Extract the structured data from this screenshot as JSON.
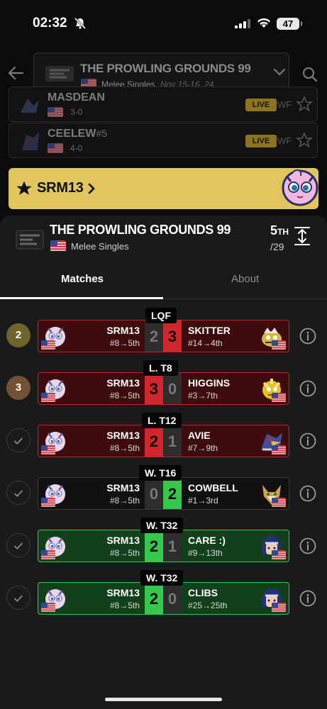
{
  "status_bar": {
    "time": "02:32",
    "battery": "47"
  },
  "top_bar": {
    "tournament_title": "THE PROWLING GROUNDS 99",
    "game": "Melee Singles",
    "dates": "Nov 15-16, 24"
  },
  "background_rows": [
    {
      "name": "MASDEAN",
      "seed": "",
      "record": "3-0",
      "live": "LIVE",
      "round": "WF"
    },
    {
      "name": "CEELEW",
      "seed": "#5",
      "record": "4-0",
      "live": "LIVE",
      "round": "WF"
    }
  ],
  "player_banner": {
    "name": "SRM13"
  },
  "sheet": {
    "title": "THE PROWLING GROUNDS 99",
    "game": "Melee Singles",
    "placing": "5",
    "placing_suffix": "TH",
    "entrants": "/29"
  },
  "tabs": [
    {
      "label": "Matches"
    },
    {
      "label": "About"
    }
  ],
  "matches": [
    {
      "status": "2",
      "round": "LQF",
      "box": "loss",
      "p1": "SRM13",
      "p1_seed": "#8→5th",
      "s1": "2",
      "s2": "3",
      "s1_style": "dim",
      "s2_style": "red",
      "p2": "SKITTER",
      "p2_seed": "#14→4th",
      "p2_char": "bowser"
    },
    {
      "status": "3",
      "round": "L. T8",
      "box": "loss",
      "p1": "SRM13",
      "p1_seed": "#8→5th",
      "s1": "3",
      "s2": "0",
      "s1_style": "red",
      "s2_style": "dim",
      "p2": "HIGGINS",
      "p2_seed": "#3→7th",
      "p2_char": "yellow"
    },
    {
      "status": "check",
      "round": "L. T12",
      "box": "loss",
      "p1": "SRM13",
      "p1_seed": "#8→5th",
      "s1": "2",
      "s2": "1",
      "s1_style": "red",
      "s2_style": "dim",
      "p2": "AVIE",
      "p2_seed": "#7→9th",
      "p2_char": "falco"
    },
    {
      "status": "check",
      "round": "W. T16",
      "box": "neutral",
      "p1": "SRM13",
      "p1_seed": "#8→5th",
      "s1": "0",
      "s2": "2",
      "s1_style": "dim",
      "s2_style": "grn",
      "p2": "COWBELL",
      "p2_seed": "#1→3rd",
      "p2_char": "fox"
    },
    {
      "status": "check",
      "round": "W. T32",
      "box": "win",
      "p1": "SRM13",
      "p1_seed": "#8→5th",
      "s1": "2",
      "s2": "1",
      "s1_style": "grn",
      "s2_style": "dim",
      "p2": "CARE :)",
      "p2_seed": "#9→13th",
      "p2_char": "marth"
    },
    {
      "status": "check",
      "round": "W. T32",
      "box": "win",
      "p1": "SRM13",
      "p1_seed": "#8→5th",
      "s1": "2",
      "s2": "0",
      "s1_style": "grn",
      "s2_style": "dim",
      "p2": "CLIBS",
      "p2_seed": "#25→25th",
      "p2_char": "marth"
    }
  ],
  "colors": {
    "accent_yellow": "#e2c65d",
    "loss_red": "#d1262b",
    "win_green": "#35c94b",
    "background": "#0b0b0b",
    "sheet": "#1a1a1a"
  },
  "icons": [
    "bell-slash-icon",
    "signal-icon",
    "wifi-icon",
    "back-arrow-icon",
    "chevron-down-icon",
    "search-icon",
    "star-icon",
    "chevron-right-icon",
    "expand-icon",
    "check-icon",
    "info-icon",
    "us-flag-icon"
  ]
}
